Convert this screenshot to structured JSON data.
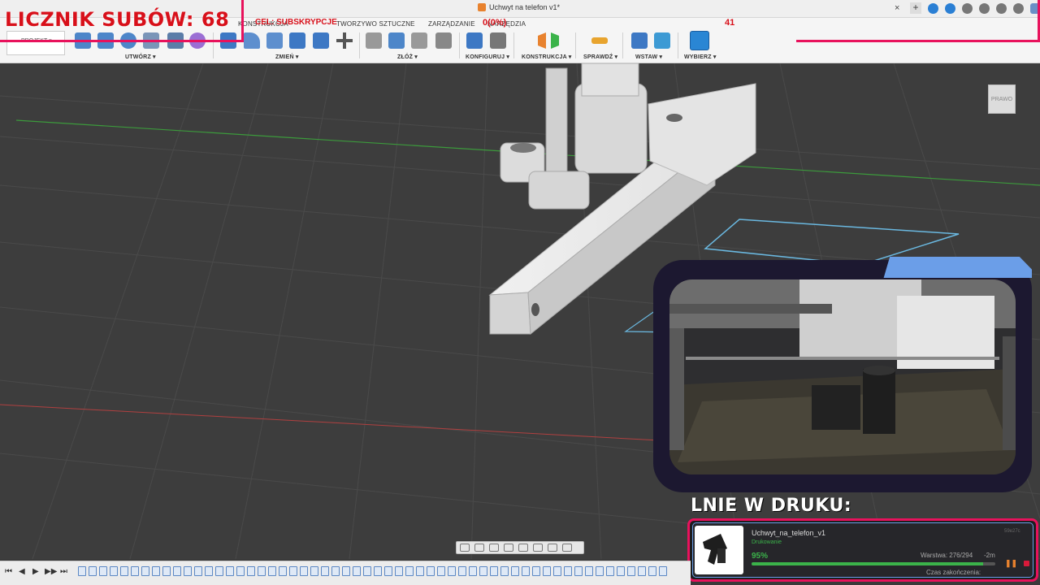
{
  "app": {
    "document_title": "Uchwyt na telefon v1*",
    "close_tab": "×",
    "new_tab": "+"
  },
  "ribbon": {
    "project_label": "PROJEKT ▾",
    "tabs": [
      "KONSTRUKCJA",
      "TWORZYWO SZTUCZNE",
      "ZARZĄDZANIE",
      "NARZĘDZIA"
    ],
    "groups": [
      "UTWÓRZ ▾",
      "ZMIEŃ ▾",
      "ZŁÓŻ ▾",
      "KONFIGURUJ ▾",
      "KONSTRUKCJA ▾",
      "SPRAWDŹ ▾",
      "WSTAW ▾",
      "WYBIERZ ▾"
    ]
  },
  "overlay": {
    "sub_counter": "LICZNIK SUBÓW: 68",
    "goal_label": "CEL: SUBSKRYPCJE",
    "goal_progress": "0(0%)",
    "goal_target": "41",
    "accent_color": "#e8125c",
    "text_color": "#d8101a"
  },
  "viewcube": {
    "face_label": "PRAWO"
  },
  "print_panel": {
    "title": "LNIE W DRUKU:",
    "job_name": "Uchwyt_na_telefon_v1",
    "job_id": "59e27c",
    "status": "Drukowanie",
    "percent": "95%",
    "progress_fraction": 0.95,
    "layer": "Warstwa: 276/294",
    "remaining": "-2m",
    "finish_label": "Czas zakończenia:",
    "pause_icon": "pause-icon",
    "stop_icon": "stop-icon"
  },
  "timeline": {
    "controls": [
      "⏮",
      "◀",
      "▶",
      "▶▶",
      "⏭"
    ]
  }
}
